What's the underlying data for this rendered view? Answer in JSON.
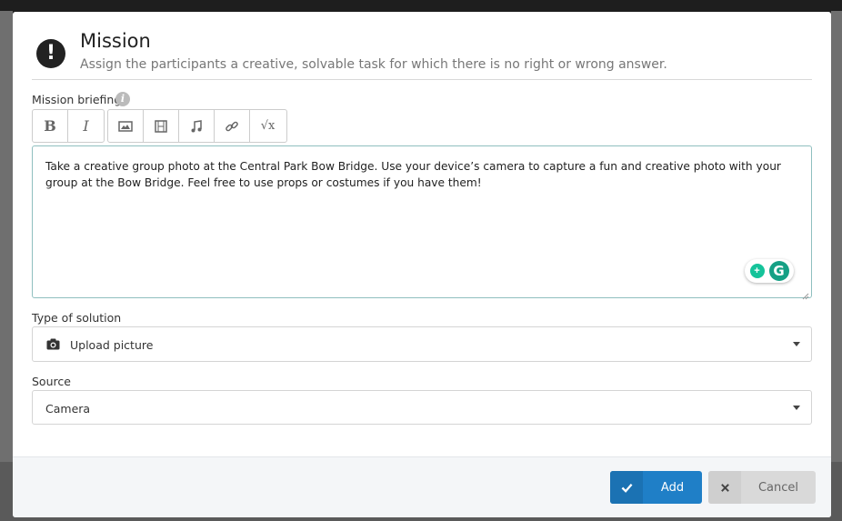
{
  "header": {
    "title": "Mission",
    "subtitle": "Assign the participants a creative, solvable task for which there is no right or wrong answer."
  },
  "briefing": {
    "label": "Mission briefing",
    "toolbar": [
      {
        "name": "bold",
        "label": "B"
      },
      {
        "name": "italic",
        "label": "I"
      },
      {
        "name": "image",
        "icon": "image-icon"
      },
      {
        "name": "video",
        "icon": "film-icon"
      },
      {
        "name": "audio",
        "icon": "music-icon"
      },
      {
        "name": "link",
        "icon": "link-icon"
      },
      {
        "name": "formula",
        "label": "√x"
      }
    ],
    "text": "Take a creative group photo at the Central Park Bow Bridge. Use your device’s camera to capture a fun and creative photo with your group at the Bow Bridge. Feel free to use props or costumes if you have them!"
  },
  "solution": {
    "label": "Type of solution",
    "value": "Upload picture",
    "icon": "camera-icon"
  },
  "source": {
    "label": "Source",
    "value": "Camera"
  },
  "footer": {
    "add_label": "Add",
    "cancel_label": "Cancel"
  },
  "colors": {
    "primary": "#1f7fc7",
    "editor_border": "#8fbfbf",
    "grammarly": "#15c39a"
  }
}
